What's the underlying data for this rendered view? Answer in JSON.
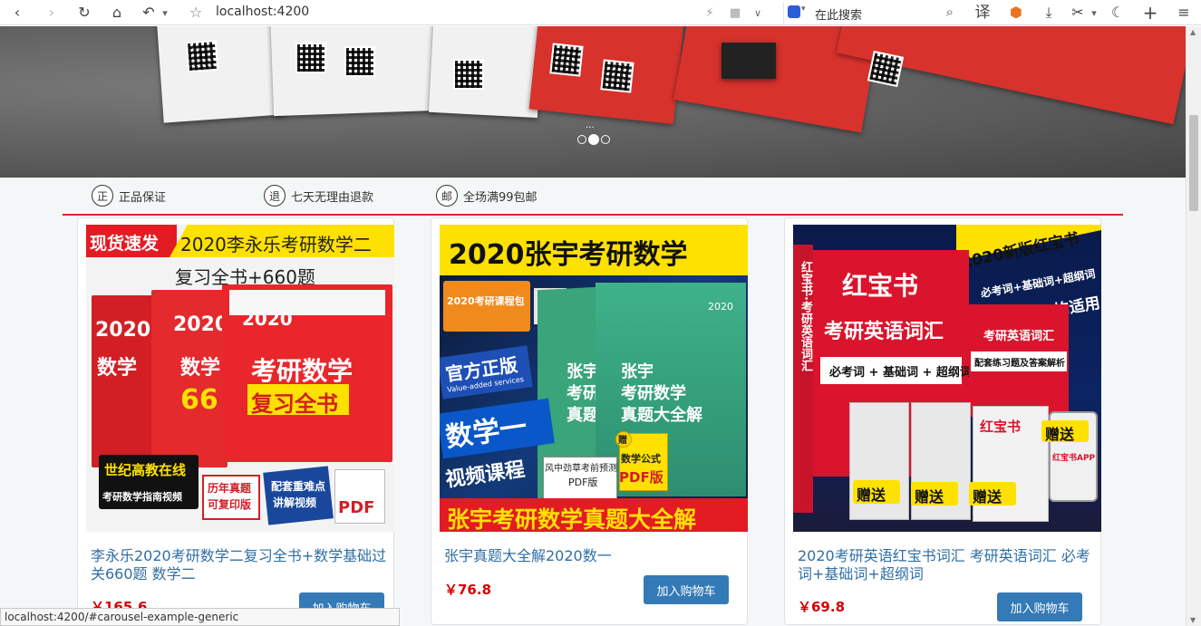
{
  "browser": {
    "address": "localhost:4200",
    "search_placeholder": "在此搜索",
    "translate_label": "译",
    "status_url": "localhost:4200/#carousel-example-generic"
  },
  "carousel": {
    "caption": "...",
    "indicator_count": 3,
    "active_index": 1
  },
  "guarantees": [
    {
      "icon": "正",
      "label": "正品保证"
    },
    {
      "icon": "退",
      "label": "七天无理由退款"
    },
    {
      "icon": "邮",
      "label": "全场满99包邮"
    }
  ],
  "products": [
    {
      "title": "李永乐2020考研数学二复习全书+数学基础过关660题 数学二",
      "price": "￥165.6",
      "button": "加入购物车",
      "cover": {
        "top_left": "现货速发",
        "top_right": "2020李永乐考研数学二",
        "subtitle": "复习全书+660题",
        "book_year": "2020",
        "book_title_1": "考研数学",
        "book_title_2": "复习全书",
        "side_1": "数学",
        "side_2": "66",
        "badge_1": "世纪高教在线",
        "badge_2": "考研数学指南视频",
        "badge_3": "历年真题",
        "badge_4": "可复印版",
        "badge_5": "配套重难点",
        "badge_6": "讲解视频",
        "badge_7": "PDF"
      }
    },
    {
      "title": "张宇真题大全解2020数一",
      "price": "￥76.8",
      "button": "加入购物车",
      "cover": {
        "headline": "2020张宇考研数学",
        "pack": "2020考研课程包",
        "official": "官方正版",
        "official_en": "Value-added services",
        "math_one": "数学一",
        "video": "视频课程",
        "book_a": "张宇",
        "book_a2": "考研数学",
        "book_a3": "真题大全解",
        "book_b": "张宇",
        "book_b2": "考研",
        "book_b3": "真题",
        "pdf_1": "风中劲草考前预测",
        "pdf_2": "PDF版",
        "pdf_3": "数学公式",
        "pdf_4": "PDF版",
        "gift": "赠",
        "footer": "张宇考研数学真题大全解",
        "book_year": "2020"
      }
    },
    {
      "title": "2020考研英语红宝书词汇 考研英语词汇 必考词+基础词+超纲词",
      "price": "￥69.8",
      "button": "加入购物车",
      "cover": {
        "banner": "2020新版红宝书",
        "line_1": "必考词+基础词+超纲词",
        "line_2": "英语一二均适用",
        "brand": "红宝书",
        "title": "考研英语词汇",
        "sub": "必考词 + 基础词 + 超纲词",
        "side": "红宝书·考研英语词汇",
        "mini_title": "考研英语词汇",
        "mini_sub": "配套练习题及答案解析",
        "gift": "赠送",
        "app": "红宝书APP"
      }
    }
  ]
}
